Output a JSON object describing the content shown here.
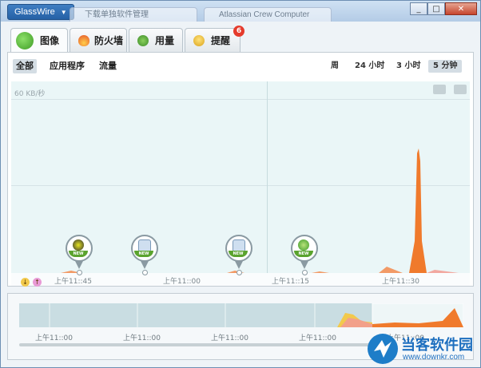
{
  "window": {
    "app_menu": "GlassWire",
    "background_tabs": [
      "下载单独软件管理",
      "Atlassian Crew Computer"
    ],
    "controls": {
      "minimize": "_",
      "maximize": "□",
      "close": "✕"
    }
  },
  "tabs": [
    {
      "label": "图像",
      "icon": "graph-icon",
      "active": true
    },
    {
      "label": "防火墙",
      "icon": "flame-icon",
      "active": false
    },
    {
      "label": "用量",
      "icon": "usage-icon",
      "active": false
    },
    {
      "label": "提醒",
      "icon": "bulb-icon",
      "active": false,
      "badge": "6"
    }
  ],
  "filters": [
    "全部",
    "应用程序",
    "流量"
  ],
  "ranges": [
    "周",
    "24 小时",
    "3 小时",
    "5 分钟"
  ],
  "graph": {
    "y_label": "60 KB/秒",
    "time_labels": [
      "上午11::45",
      "上午11::00",
      "上午11::15",
      "上午11::30"
    ],
    "new_tag": "NEW"
  },
  "legend": {
    "download_icon": "↓",
    "upload_icon": "↑"
  },
  "overview": {
    "time_labels": [
      "上午11::00",
      "上午11::00",
      "上午11::00",
      "上午11::00",
      "上午11::00"
    ]
  },
  "watermark": {
    "title": "当客软件园",
    "url": "www.downkr.com"
  },
  "colors": {
    "accent": "#2e6db2",
    "upload": "#f07a2c",
    "download": "#f2c94c",
    "new_badge": "#5aa32e",
    "graph_bg": "#eaf6f7"
  }
}
